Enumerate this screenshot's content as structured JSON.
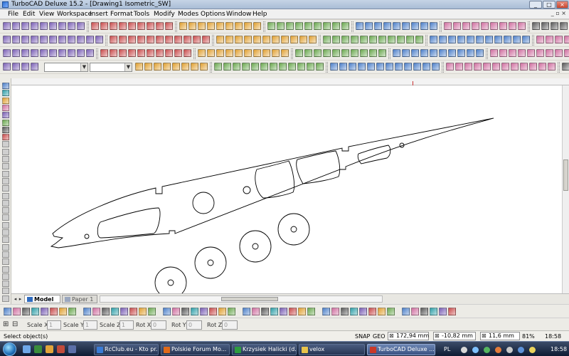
{
  "window": {
    "title": "TurboCAD Deluxe 15.2 - [Drawing1 Isometric_SW]"
  },
  "menu": [
    "File",
    "Edit",
    "View",
    "Workspace",
    "Insert",
    "Format",
    "Tools",
    "Modify",
    "Modes",
    "Options",
    "Window",
    "Help"
  ],
  "tabs": [
    {
      "label": "Model",
      "active": true
    },
    {
      "label": "Paper 1",
      "active": false
    }
  ],
  "inspector": [
    {
      "label": "Scale X",
      "value": "1"
    },
    {
      "label": "Scale Y",
      "value": "1"
    },
    {
      "label": "Scale Z",
      "value": "1"
    },
    {
      "label": "Rot X",
      "value": "0"
    },
    {
      "label": "Rot Y",
      "value": "0"
    },
    {
      "label": "Rot Z",
      "value": "0"
    }
  ],
  "status": {
    "message": "Select object(s)",
    "snap": "SNAP",
    "geo": "GEO",
    "x": "172,94 mm",
    "y": "-10,82 mm",
    "z": "11,6 mm",
    "zoom": "81%",
    "time": "18:58"
  },
  "taskbar": {
    "items": [
      {
        "label": "RcClub.eu - Kto pr...",
        "color": "#3a7bd5"
      },
      {
        "label": "Polskie Forum Mo...",
        "color": "#e06a1a"
      },
      {
        "label": "Krzysiek Halicki (d...",
        "color": "#2e9c3f"
      },
      {
        "label": "velox",
        "color": "#e8c34a"
      },
      {
        "label": "TurboCAD Deluxe ...",
        "color": "#c93a2a"
      }
    ],
    "lang": "PL",
    "clock": "18:58"
  },
  "icons": {
    "toolbar_colors": [
      "#4c7fc9",
      "#6aa84f",
      "#e0a030",
      "#c94c4c",
      "#7a5fb5",
      "#2f9fa8",
      "#5a5a5a",
      "#d06fa0"
    ]
  }
}
